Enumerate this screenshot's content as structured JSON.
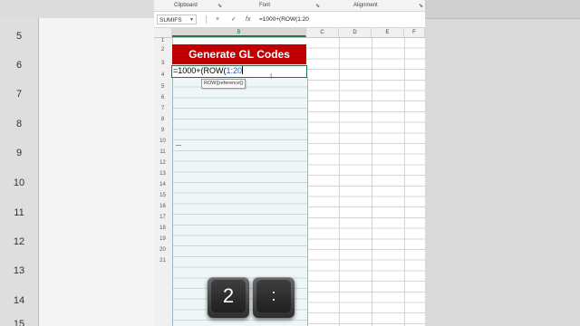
{
  "background": {
    "row_numbers": [
      "5",
      "6",
      "7",
      "8",
      "9",
      "10",
      "11",
      "12",
      "13",
      "14",
      "15"
    ]
  },
  "ribbon": {
    "groups": [
      "Clipboard",
      "Font",
      "Alignment"
    ]
  },
  "formula_bar": {
    "name_box": "SUMIFS",
    "cancel_icon": "×",
    "enter_icon": "✓",
    "fx_label": "fx",
    "formula": "=1000+(ROW(1:20"
  },
  "columns": [
    "B",
    "C",
    "D",
    "E",
    "F"
  ],
  "rows": [
    "1",
    "2",
    "3",
    "4",
    "5",
    "6",
    "7",
    "8",
    "9",
    "10",
    "11",
    "12",
    "13",
    "14",
    "15",
    "16",
    "17",
    "18",
    "19",
    "20",
    "21"
  ],
  "sheet": {
    "title_cell": "Generate GL Codes",
    "edit_prefix": "=1000+(ROW(",
    "edit_ref": "1:20",
    "tooltip": "ROW([reference])"
  },
  "keys": [
    "2",
    ":"
  ],
  "colors": {
    "accent_green": "#217346",
    "title_red": "#c00000",
    "ref_blue": "#1f5fb4"
  }
}
